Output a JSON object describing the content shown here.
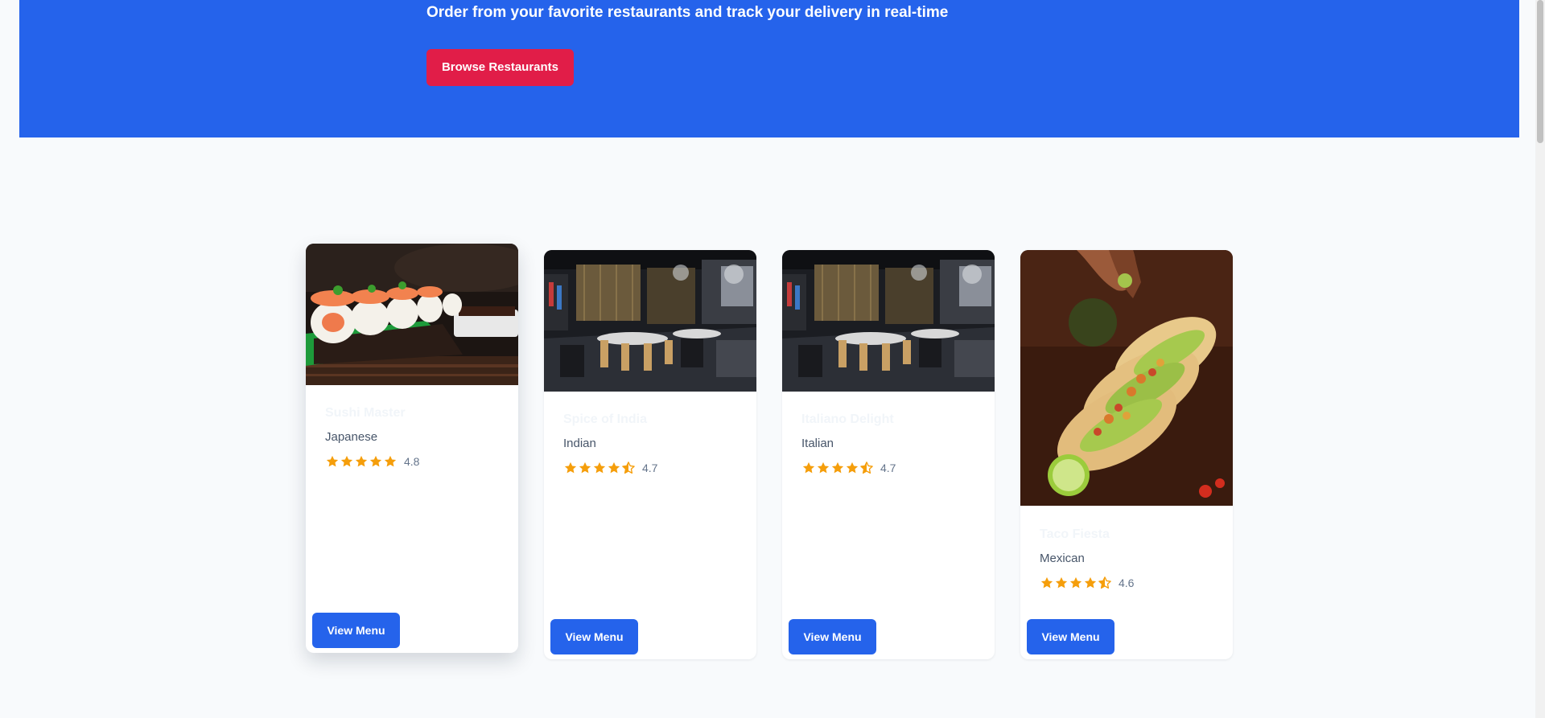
{
  "hero": {
    "subtitle": "Order from your favorite restaurants and track your delivery in real-time",
    "browse_label": "Browse Restaurants",
    "background_color": "#2563eb",
    "button_color": "#e11d48"
  },
  "restaurants": [
    {
      "name": "Sushi Master",
      "cuisine": "Japanese",
      "rating": "4.8",
      "stars": 5,
      "image": "sushi-photo",
      "button_label": "View Menu"
    },
    {
      "name": "Spice of India",
      "cuisine": "Indian",
      "rating": "4.7",
      "stars": 4.5,
      "image": "restaurant-interior-photo",
      "button_label": "View Menu"
    },
    {
      "name": "Italiano Delight",
      "cuisine": "Italian",
      "rating": "4.7",
      "stars": 4.5,
      "image": "restaurant-interior-photo",
      "button_label": "View Menu"
    },
    {
      "name": "Taco Fiesta",
      "cuisine": "Mexican",
      "rating": "4.6",
      "stars": 4.5,
      "image": "tacos-photo",
      "button_label": "View Menu"
    }
  ],
  "colors": {
    "accent": "#2563eb",
    "star": "#f59e0b",
    "page_background": "#f8fafc"
  }
}
